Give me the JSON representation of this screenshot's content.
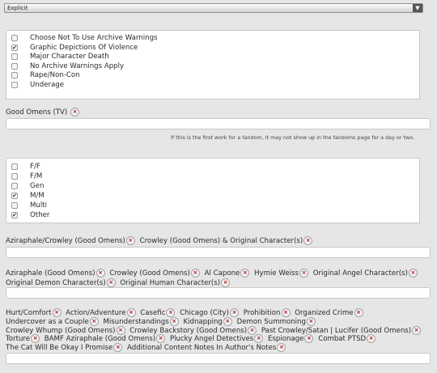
{
  "rating": {
    "selected": "Explicit",
    "arrow": "▼"
  },
  "warnings": [
    {
      "label": "Choose Not To Use Archive Warnings",
      "checked": false
    },
    {
      "label": "Graphic Depictions Of Violence",
      "checked": true
    },
    {
      "label": "Major Character Death",
      "checked": false
    },
    {
      "label": "No Archive Warnings Apply",
      "checked": false
    },
    {
      "label": "Rape/Non-Con",
      "checked": false
    },
    {
      "label": "Underage",
      "checked": false
    }
  ],
  "fandom": {
    "tags": [
      "Good Omens (TV)"
    ],
    "note": "If this is the first work for a fandom, it may not show up in the fandoms page for a day or two."
  },
  "categories": [
    {
      "label": "F/F",
      "checked": false
    },
    {
      "label": "F/M",
      "checked": false
    },
    {
      "label": "Gen",
      "checked": false
    },
    {
      "label": "M/M",
      "checked": true
    },
    {
      "label": "Multi",
      "checked": false
    },
    {
      "label": "Other",
      "checked": true
    }
  ],
  "relationships": {
    "lines": [
      [
        "Aziraphale/Crowley (Good Omens)",
        "Crowley (Good Omens) & Original Character(s)"
      ]
    ]
  },
  "characters": {
    "lines": [
      [
        "Aziraphale (Good Omens)",
        "Crowley (Good Omens)",
        "Al Capone",
        "Hymie Weiss",
        "Original Angel Character(s)"
      ],
      [
        "Original Demon Character(s)",
        "Original Human Character(s)"
      ]
    ]
  },
  "freeforms": {
    "lines": [
      [
        "Hurt/Comfort",
        "Action/Adventure",
        "Casefic",
        "Chicago (City)",
        "Prohibition",
        "Organized Crime"
      ],
      [
        "Undercover as a Couple",
        "Misunderstandings",
        "Kidnapping",
        "Demon Summoning"
      ],
      [
        "Crowley Whump (Good Omens)",
        "Crowley Backstory (Good Omens)",
        "Past Crowley/Satan | Lucifer (Good Omens)"
      ],
      [
        "Torture",
        "BAMF Aziraphale (Good Omens)",
        "Plucky Angel Detectives",
        "Espionage",
        "Combat PTSD"
      ],
      [
        "The Cat Will Be Okay I Promise",
        "Additional Content Notes In Author's Notes"
      ]
    ]
  },
  "remove_symbol": "×"
}
